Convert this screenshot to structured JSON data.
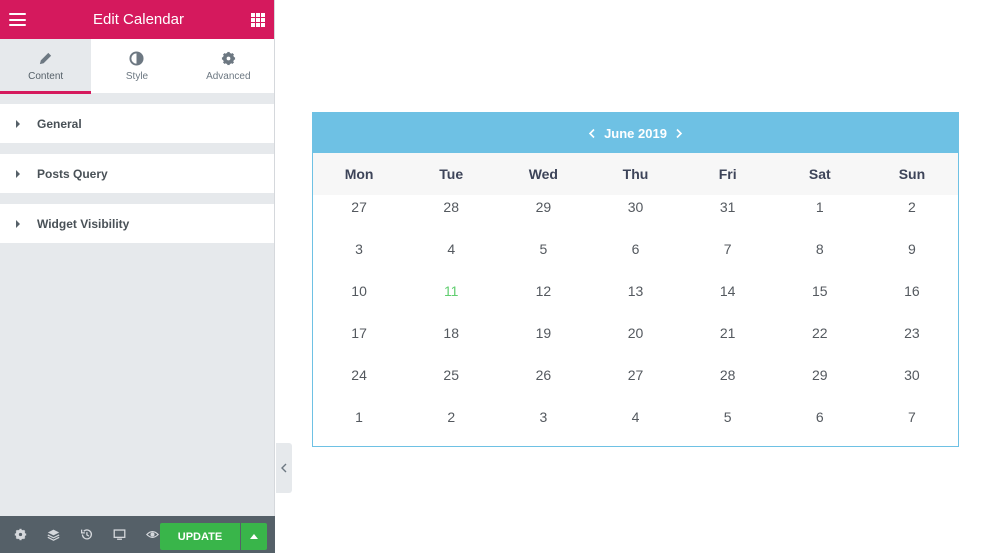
{
  "topbar": {
    "title": "Edit Calendar",
    "color": "#d5195d"
  },
  "tabs": [
    {
      "label": "Content",
      "icon": "pencil-icon",
      "active": true
    },
    {
      "label": "Style",
      "icon": "half-circle-icon",
      "active": false
    },
    {
      "label": "Advanced",
      "icon": "gear-icon",
      "active": false
    }
  ],
  "sections": [
    {
      "label": "General"
    },
    {
      "label": "Posts Query"
    },
    {
      "label": "Widget Visibility"
    }
  ],
  "footer": {
    "icons": [
      "settings-icon",
      "navigator-layers-icon",
      "history-icon",
      "responsive-desktop-icon",
      "preview-eye-icon"
    ],
    "update_label": "UPDATE",
    "update_color": "#39b54a"
  },
  "calendar": {
    "month": "June 2019",
    "header_color": "#6ec1e4",
    "weekdays": [
      "Mon",
      "Tue",
      "Wed",
      "Thu",
      "Fri",
      "Sat",
      "Sun"
    ],
    "weeks": [
      [
        "27",
        "28",
        "29",
        "30",
        "31",
        "1",
        "2"
      ],
      [
        "3",
        "4",
        "5",
        "6",
        "7",
        "8",
        "9"
      ],
      [
        "10",
        "11",
        "12",
        "13",
        "14",
        "15",
        "16"
      ],
      [
        "17",
        "18",
        "19",
        "20",
        "21",
        "22",
        "23"
      ],
      [
        "24",
        "25",
        "26",
        "27",
        "28",
        "29",
        "30"
      ],
      [
        "1",
        "2",
        "3",
        "4",
        "5",
        "6",
        "7"
      ]
    ],
    "highlighted_day": "11"
  }
}
